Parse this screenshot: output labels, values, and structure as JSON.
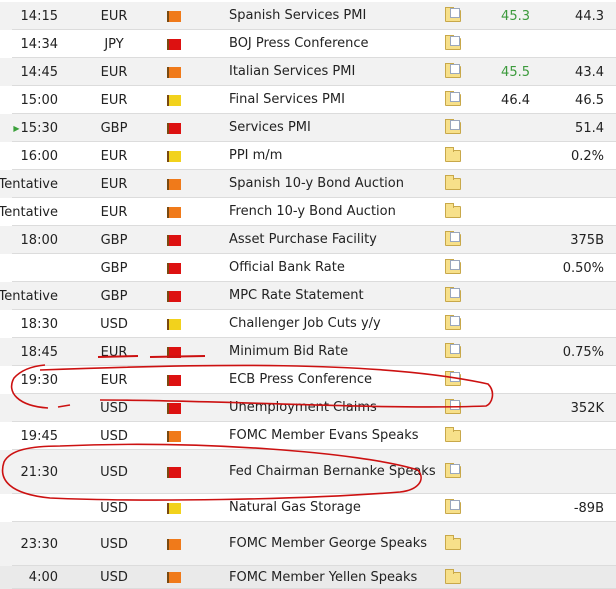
{
  "colors": {
    "high_impact": "#dd1111",
    "medium_impact": "#f07a1a",
    "low_impact": "#f2d21c",
    "positive_actual": "#3c9a3c",
    "annotation": "#cc1111"
  },
  "rows": [
    {
      "time": "14:15",
      "currency": "EUR",
      "impact": "medium",
      "event": "Spanish Services PMI",
      "icon": "folder-doc-icon",
      "actual": "45.3",
      "actual_positive": true,
      "forecast": "44.3"
    },
    {
      "time": "14:34",
      "currency": "JPY",
      "impact": "high",
      "event": "BOJ Press Conference",
      "icon": "folder-doc-icon",
      "actual": "",
      "forecast": ""
    },
    {
      "time": "14:45",
      "currency": "EUR",
      "impact": "medium",
      "event": "Italian Services PMI",
      "icon": "folder-doc-icon",
      "actual": "45.5",
      "actual_positive": true,
      "forecast": "43.4"
    },
    {
      "time": "15:00",
      "currency": "EUR",
      "impact": "low",
      "event": "Final Services PMI",
      "icon": "folder-doc-icon",
      "actual": "46.4",
      "forecast": "46.5"
    },
    {
      "time": "15:30",
      "time_marker": "▶",
      "currency": "GBP",
      "impact": "high",
      "event": "Services PMI",
      "icon": "folder-doc-icon",
      "actual": "",
      "forecast": "51.4"
    },
    {
      "time": "16:00",
      "currency": "EUR",
      "impact": "low",
      "event": "PPI m/m",
      "icon": "folder-icon",
      "actual": "",
      "forecast": "0.2%"
    },
    {
      "time": "Tentative",
      "currency": "EUR",
      "impact": "medium",
      "event": "Spanish 10-y Bond Auction",
      "icon": "folder-icon",
      "actual": "",
      "forecast": ""
    },
    {
      "time": "Tentative",
      "currency": "EUR",
      "impact": "medium",
      "event": "French 10-y Bond Auction",
      "icon": "folder-icon",
      "actual": "",
      "forecast": ""
    },
    {
      "time": "18:00",
      "currency": "GBP",
      "impact": "high",
      "event": "Asset Purchase Facility",
      "icon": "folder-doc-icon",
      "actual": "",
      "forecast": "375B"
    },
    {
      "time": "",
      "currency": "GBP",
      "impact": "high",
      "event": "Official Bank Rate",
      "icon": "folder-doc-icon",
      "actual": "",
      "forecast": "0.50%"
    },
    {
      "time": "Tentative",
      "currency": "GBP",
      "impact": "high",
      "event": "MPC Rate Statement",
      "icon": "folder-doc-icon",
      "actual": "",
      "forecast": ""
    },
    {
      "time": "18:30",
      "currency": "USD",
      "impact": "low",
      "event": "Challenger Job Cuts y/y",
      "icon": "folder-doc-icon",
      "actual": "",
      "forecast": ""
    },
    {
      "time": "18:45",
      "currency": "EUR",
      "impact": "high",
      "event": "Minimum Bid Rate",
      "icon": "folder-doc-icon",
      "actual": "",
      "forecast": "0.75%"
    },
    {
      "time": "19:30",
      "currency": "EUR",
      "impact": "high",
      "event": "ECB Press Conference",
      "icon": "folder-doc-icon",
      "actual": "",
      "forecast": ""
    },
    {
      "time": "",
      "currency": "USD",
      "impact": "high",
      "event": "Unemployment Claims",
      "icon": "folder-doc-icon",
      "actual": "",
      "forecast": "352K"
    },
    {
      "time": "19:45",
      "currency": "USD",
      "impact": "medium",
      "event": "FOMC Member Evans Speaks",
      "icon": "folder-icon",
      "actual": "",
      "forecast": ""
    },
    {
      "time": "21:30",
      "currency": "USD",
      "impact": "high",
      "event": "Fed Chairman Bernanke Speaks",
      "icon": "folder-doc-icon",
      "actual": "",
      "forecast": ""
    },
    {
      "time": "",
      "currency": "USD",
      "impact": "low",
      "event": "Natural Gas Storage",
      "icon": "folder-doc-icon",
      "actual": "",
      "forecast": "-89B"
    },
    {
      "time": "23:30",
      "currency": "USD",
      "impact": "medium",
      "event": "FOMC Member George Speaks",
      "icon": "folder-icon",
      "actual": "",
      "forecast": ""
    },
    {
      "time": "4:00",
      "currency": "USD",
      "impact": "medium",
      "event": "FOMC Member Yellen Speaks",
      "icon": "folder-icon",
      "actual": "",
      "forecast": ""
    }
  ]
}
